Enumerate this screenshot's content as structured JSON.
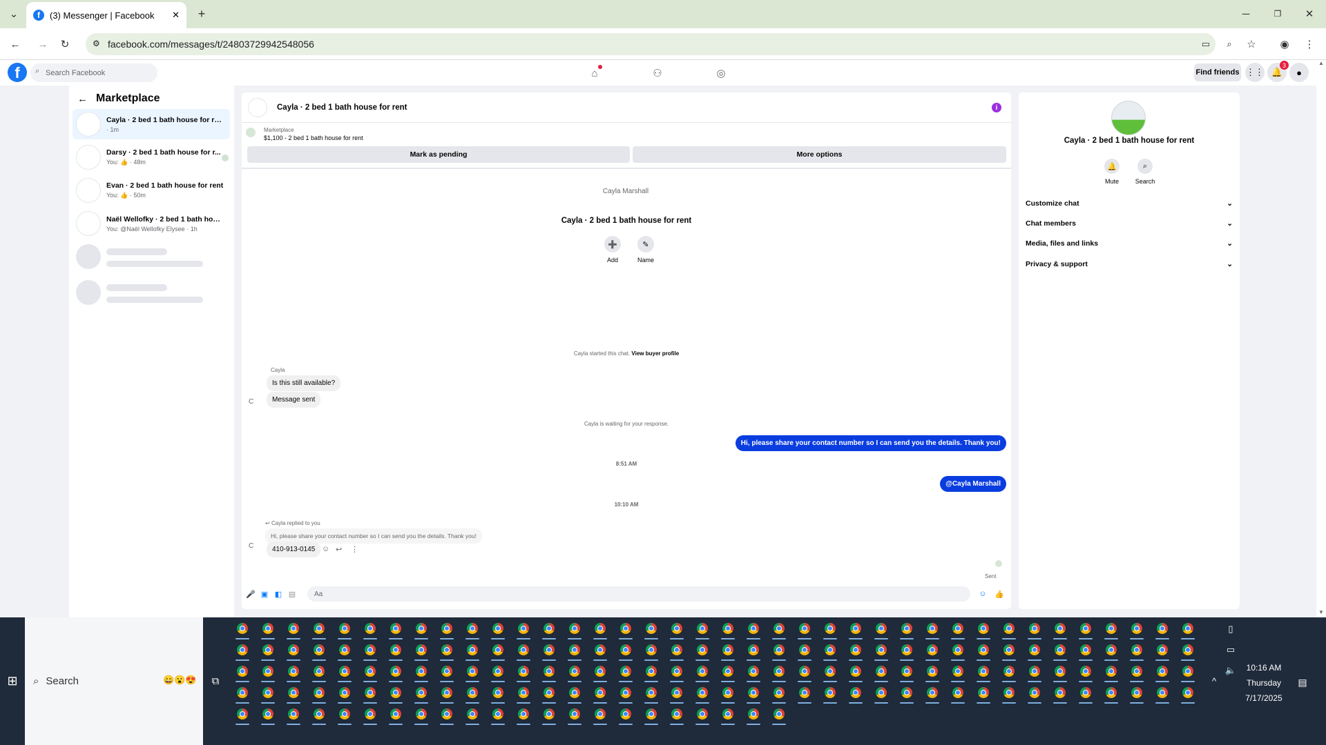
{
  "browser": {
    "tab_title": "(3) Messenger | Facebook",
    "url": "facebook.com/messages/t/24803729942548056"
  },
  "fb": {
    "search_placeholder": "Search Facebook",
    "find_friends": "Find friends",
    "notification_count": "3"
  },
  "left": {
    "title": "Marketplace",
    "conversations": [
      {
        "name": "Cayla · 2 bed 1 bath house for rent",
        "sub": "· 1m"
      },
      {
        "name": "Darsy · 2 bed 1 bath house for r...",
        "sub": "You: 👍 · 48m"
      },
      {
        "name": "Evan · 2 bed 1 bath house for rent",
        "sub": "You: 👍 · 50m"
      },
      {
        "name": "Naël Wellofky · 2 bed 1 bath house...",
        "sub": "You: @Naël Wellofky Elysee · 1h"
      }
    ]
  },
  "chat": {
    "header_title": "Cayla · 2 bed 1 bath house for rent",
    "listing_label": "Marketplace",
    "listing_text": "$1,100 - 2 bed 1 bath house for rent",
    "mark_pending": "Mark as pending",
    "more_options": "More options",
    "avatar_alt": "Cayla Marshall",
    "intro_title": "Cayla · 2 bed 1 bath house for rent",
    "add_label": "Add",
    "name_label": "Name",
    "started_text": "Cayla started this chat.",
    "view_profile": "View buyer profile",
    "sender_name": "Cayla",
    "msg1": "Is this still available?",
    "msg2": "Message sent",
    "waiting_text": "Cayla is waiting for your response.",
    "out1": "Hi, please share your contact number so I can send you the details. Thank you!",
    "time1": "8:51 AM",
    "out2": "@Cayla Marshall",
    "time2": "10:10 AM",
    "replied_label": "Cayla replied to you",
    "quoted": "Hi, please share your contact number so I can send you the details. Thank you!",
    "phone": "410-913-0145",
    "sent_label": "Sent",
    "composer_placeholder": "Aa"
  },
  "right": {
    "title": "Cayla · 2 bed 1 bath house for rent",
    "mute": "Mute",
    "search": "Search",
    "sections": [
      "Customize chat",
      "Chat members",
      "Media, files and links",
      "Privacy & support"
    ]
  },
  "taskbar": {
    "search": "Search",
    "time": "10:16 AM",
    "day": "Thursday",
    "date": "7/17/2025"
  }
}
